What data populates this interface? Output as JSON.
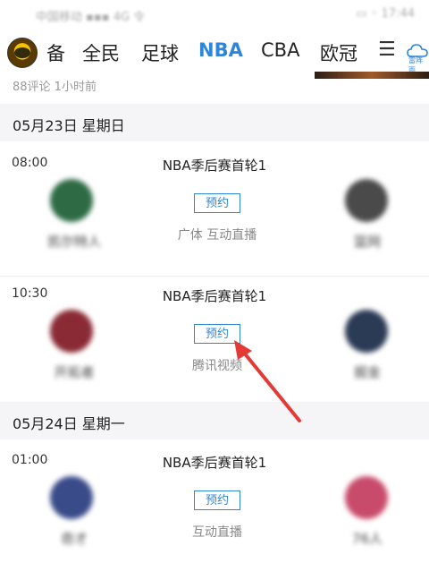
{
  "status_bar": {
    "left": "中国移动 ▪▪▪ 4G 令",
    "right": "▭ ◦ 17:44"
  },
  "nav": {
    "tabs": [
      "备",
      "全民",
      "足球",
      "NBA",
      "CBA",
      "欧冠"
    ],
    "active_tab": "NBA",
    "weather_label": "雷阵雨"
  },
  "news_meta": "88评论  1小时前",
  "days": [
    {
      "date": "05月23日 星期日",
      "matches": [
        {
          "time": "08:00",
          "title": "NBA季后赛首轮1",
          "home": "凯尔特人",
          "away": "篮网",
          "reserve": "预约",
          "broadcast": "广体 互动直播",
          "home_color": "#2e6b45",
          "away_color": "#4a4a4a"
        },
        {
          "time": "10:30",
          "title": "NBA季后赛首轮1",
          "home": "开拓者",
          "away": "掘金",
          "reserve": "预约",
          "broadcast": "腾讯视频",
          "home_color": "#8a2a35",
          "away_color": "#2b3a55"
        }
      ]
    },
    {
      "date": "05月24日 星期一",
      "matches": [
        {
          "time": "01:00",
          "title": "NBA季后赛首轮1",
          "home": "奇才",
          "away": "76人",
          "reserve": "预约",
          "broadcast": "互动直播",
          "home_color": "#3a4b8a",
          "away_color": "#c94b6b"
        }
      ]
    }
  ],
  "colors": {
    "accent": "#2f86d8",
    "annotation_arrow": "#e53935"
  }
}
